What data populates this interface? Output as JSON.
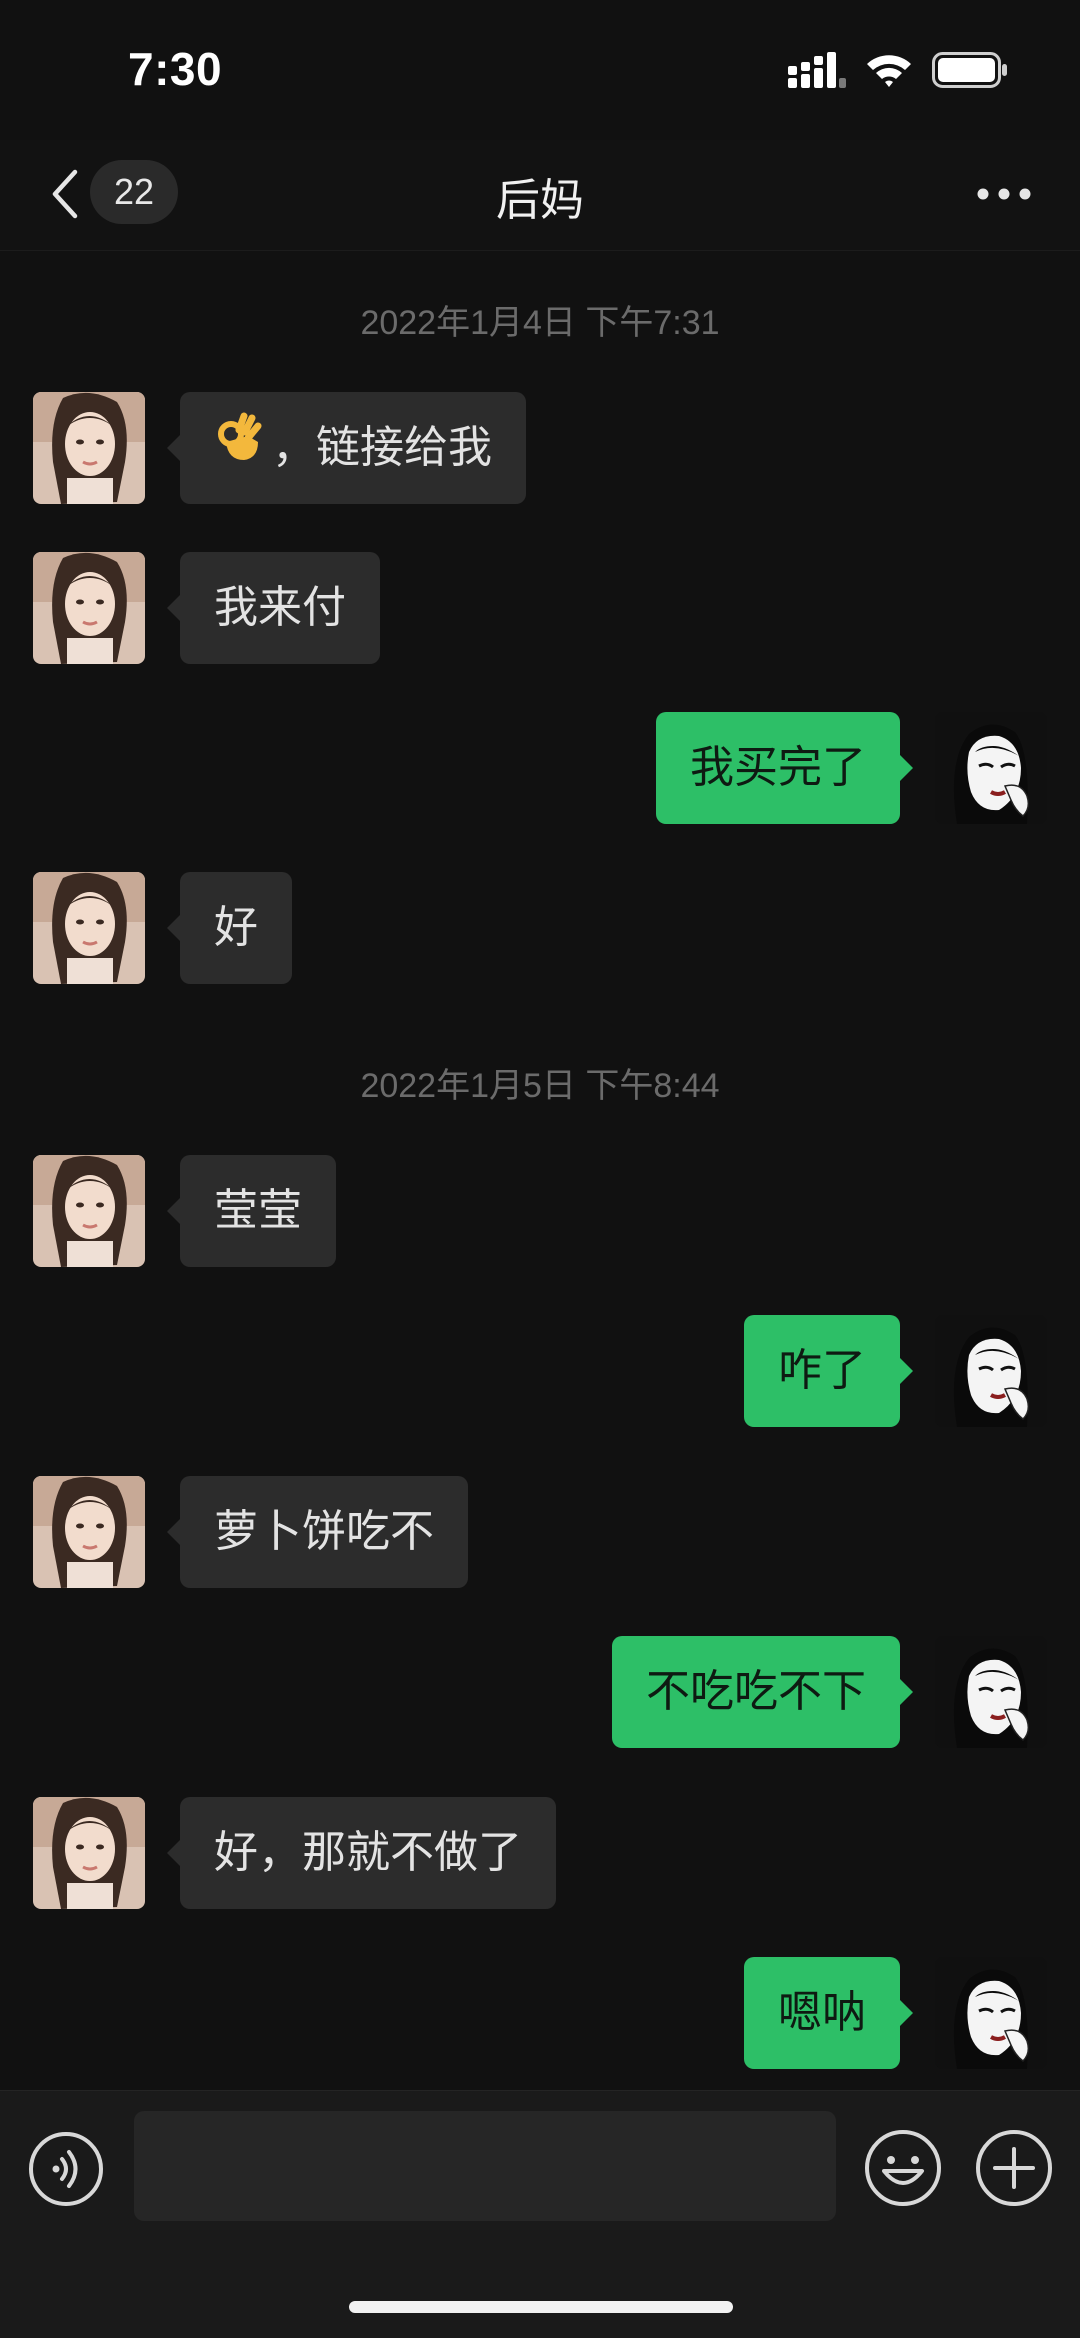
{
  "status_bar": {
    "time": "7:30",
    "icons": [
      "cellular-signal-icon",
      "wifi-icon",
      "battery-icon"
    ]
  },
  "nav": {
    "unread_count": "22",
    "title": "后妈",
    "icons": [
      "back-chevron-icon",
      "more-options-icon"
    ]
  },
  "chat": {
    "timestamps": [
      "2022年1月4日 下午7:31",
      "2022年1月5日 下午8:44"
    ],
    "messages": [
      {
        "side": "left",
        "text": "，链接给我",
        "emoji": "ok-hand-icon"
      },
      {
        "side": "left",
        "text": "我来付"
      },
      {
        "side": "right",
        "text": "我买完了"
      },
      {
        "side": "left",
        "text": "好"
      },
      {
        "side": "left",
        "text": "莹莹"
      },
      {
        "side": "right",
        "text": "咋了"
      },
      {
        "side": "left",
        "text": "萝卜饼吃不"
      },
      {
        "side": "right",
        "text": "不吃吃不下"
      },
      {
        "side": "left",
        "text": "好，那就不做了"
      },
      {
        "side": "right",
        "text": "嗯呐"
      }
    ]
  },
  "input_bar": {
    "placeholder": "",
    "icons": [
      "voice-icon",
      "emoji-icon",
      "plus-icon"
    ]
  },
  "colors": {
    "background": "#111111",
    "incoming_bubble": "#2c2c2c",
    "outgoing_bubble": "#2dbf67",
    "timestamp_text": "#6b6b6b"
  }
}
